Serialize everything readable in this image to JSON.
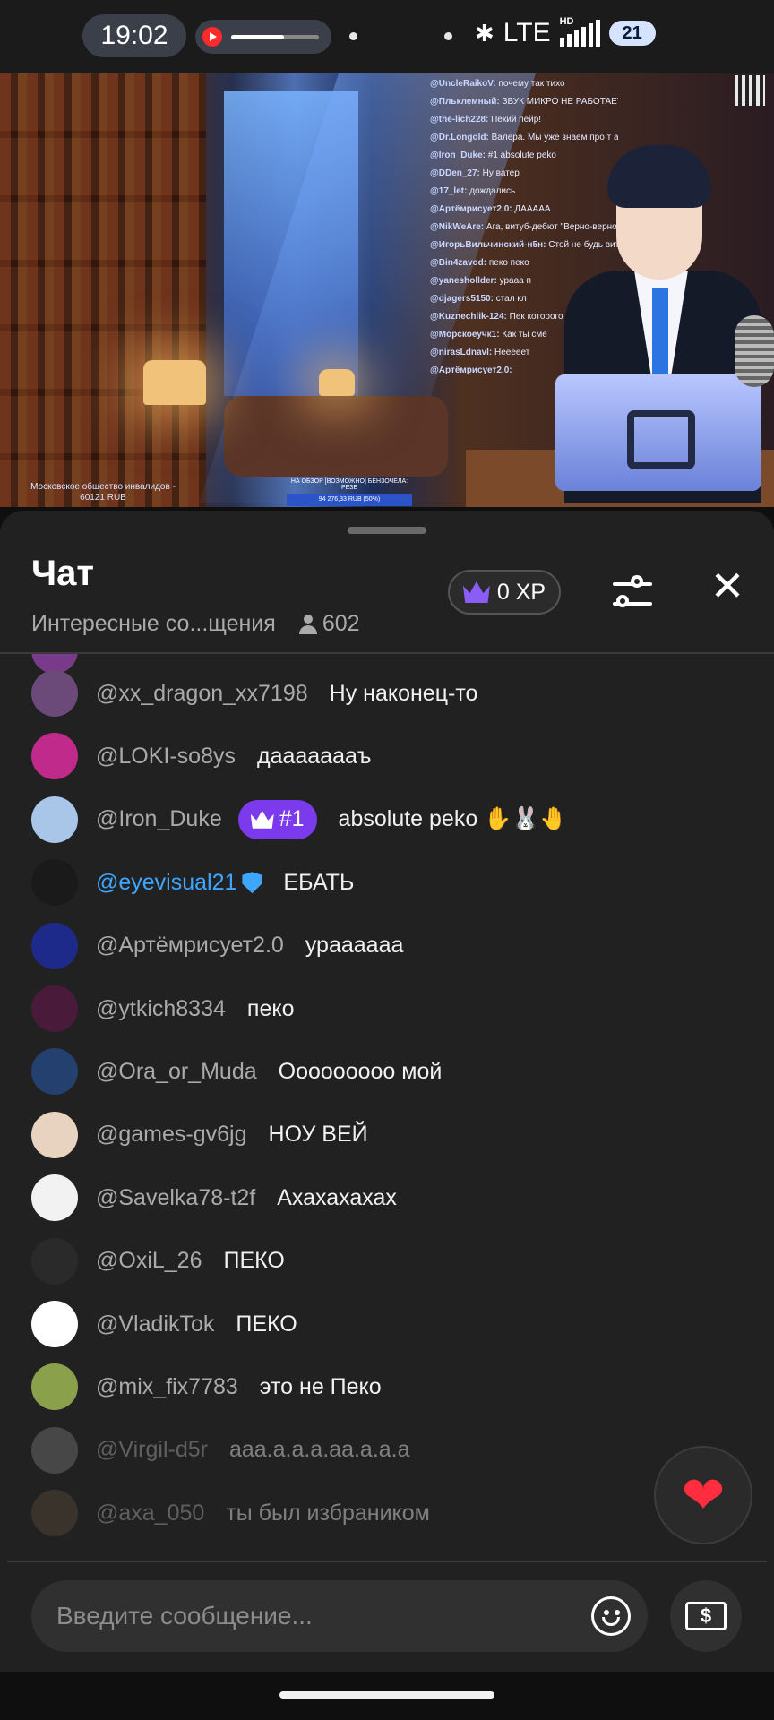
{
  "status_bar": {
    "time": "19:02",
    "network": "LTE",
    "hd": "HD",
    "battery": "21",
    "media_progress": 0.6
  },
  "video": {
    "donation_line1": "Московское общество инвалидов -",
    "donation_line2": "60121 RUB",
    "goal_title": "НА ОБЗОР [ВОЗМОЖНО] БЕНЗОЧЕЛА: РЕЗЕ",
    "goal_amount": "94 276,33 RUB (50%)",
    "stream_chat": [
      {
        "author": "@UncleRaikoV:",
        "text": "почему так тихо"
      },
      {
        "author": "@Пльклемный:",
        "text": "ЗВУК МИКРО НЕ РАБОТАЕТ"
      },
      {
        "author": "@the-lich228:",
        "text": "Пекий пейр!"
      },
      {
        "author": "@Dr.Longold:",
        "text": "Валера. Мы уже знаем про т аватар кринжролла"
      },
      {
        "author": "@Iron_Duke:",
        "text": "#1 absolute peko"
      },
      {
        "author": "@DDen_27:",
        "text": "Ну ватер"
      },
      {
        "author": "@17_let:",
        "text": "дождались"
      },
      {
        "author": "@Артёмрисует2.0:",
        "text": "ДААААА"
      },
      {
        "author": "@NikWeAre:",
        "text": "Ага, витуб-дебют \"Верно-верно\""
      },
      {
        "author": "@ИгорьВильчинский-н5н:",
        "text": "Стой не будь витубером Иисус не простит тебя"
      },
      {
        "author": "@Bin4zavod:",
        "text": "пеко пеко"
      },
      {
        "author": "@yaneshollder:",
        "text": "урааа п"
      },
      {
        "author": "@djagers5150:",
        "text": "стал кл"
      },
      {
        "author": "@Kuznechlik-124:",
        "text": "Пек которого никто не ждал, них быть не могло"
      },
      {
        "author": "@Морскоеучк1:",
        "text": "Как ты сме"
      },
      {
        "author": "@nirasLdnavl:",
        "text": "Нееееет"
      },
      {
        "author": "@Артёмрисует2.0:",
        "text": ""
      }
    ]
  },
  "chat": {
    "title": "Чат",
    "subtitle": "Интересные со...щения",
    "viewers": "602",
    "xp": "0 XP",
    "messages": [
      {
        "author": "@xx_dragon_xx7198",
        "text": "Ну наконец-то",
        "avatar_color": "#6b4a7a"
      },
      {
        "author": "@LOKI-so8ys",
        "text": "даааааааъ",
        "avatar_color": "#c02a8a"
      },
      {
        "author": "@Iron_Duke",
        "text": "absolute peko ✋🐰🤚",
        "avatar_color": "#a9c6e8",
        "rank": "#1"
      },
      {
        "author": "@eyevisual21",
        "text": "ЕБАТЬ",
        "avatar_color": "#1a1a1a",
        "verified": true
      },
      {
        "author": "@Артёмрисует2.0",
        "text": "урааааaa",
        "avatar_color": "#1e2a8a"
      },
      {
        "author": "@ytkich8334",
        "text": "пеко",
        "avatar_color": "#4a1a3a"
      },
      {
        "author": "@Ora_or_Muda",
        "text": "Ооооооооо мой",
        "avatar_color": "#23406e"
      },
      {
        "author": "@games-gv6jg",
        "text": "НОУ ВЕЙ",
        "avatar_color": "#e8d2c0"
      },
      {
        "author": "@Savelka78-t2f",
        "text": "Ахахахахах",
        "avatar_color": "#f2f2f2"
      },
      {
        "author": "@OxiL_26",
        "text": "ПЕКО",
        "avatar_color": "#2a2a2a"
      },
      {
        "author": "@VladikTok",
        "text": "ПЕКО",
        "avatar_color": "#ffffff"
      },
      {
        "author": "@mix_fix7783",
        "text": "это не Пеко",
        "avatar_color": "#8aa04a"
      },
      {
        "author": "@Virgil-d5r",
        "text": "ааа.а.а.а.аа.а.а.а",
        "avatar_color": "#777777",
        "faded": true
      },
      {
        "author": "@axa_050",
        "text": "ты был избраником",
        "avatar_color": "#5a4a3a",
        "faded": true
      }
    ],
    "input_placeholder": "Введите сообщение...",
    "donate_symbol": "$",
    "heart": "❤"
  },
  "colors": {
    "background": "#212121",
    "accent_purple": "#7c3aed",
    "verified_blue": "#3ea6ff",
    "heart_red": "#ff2d3d"
  },
  "icons": [
    "youtube-icon",
    "bluetooth-icon",
    "signal-icon",
    "person-icon",
    "crown-icon",
    "filter-icon",
    "close-icon",
    "verified-icon",
    "heart-icon",
    "emoji-icon",
    "donate-icon"
  ]
}
